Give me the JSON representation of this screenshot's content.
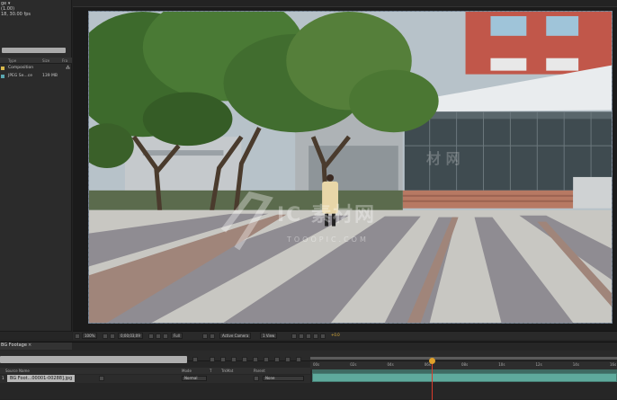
{
  "project": {
    "footage_title": "ge ▾",
    "footage_info_1": "(1.00)",
    "footage_info_2": "18, 30.00 fps",
    "columns": {
      "type": "Type",
      "size": "Size",
      "fps": "Fra"
    },
    "items": [
      {
        "type": "Composition",
        "size": "",
        "swatch": "#d8b84a",
        "icon": "composition-icon",
        "extra": "⁂"
      },
      {
        "type": "JPEG Se...ce",
        "size": "139 MB",
        "swatch": "#5aa7b0",
        "icon": "footage-icon",
        "extra": ""
      }
    ]
  },
  "viewer": {
    "watermark": "IC 素材网",
    "watermark_sub": "TOOOPIC.COM",
    "watermark_top": "材 网",
    "toolbar": {
      "zoom": "100%",
      "timecode": "0;00;03;09",
      "resolution": "Full",
      "camera": "Active Camera",
      "view": "1 View",
      "exposure": "+0.0"
    }
  },
  "timeline": {
    "tab_label": "BG Footage",
    "tab_close": "×",
    "columns": {
      "source_name": "Source Name",
      "mode": "Mode",
      "t": "T",
      "trkmat": "TrkMat",
      "parent": "Parent"
    },
    "layer": {
      "number": "1",
      "name": "BG Foot...00001-00288].jpg",
      "mode": "Normal",
      "parent": "None"
    },
    "ruler_ticks": [
      "00s",
      "02s",
      "04s",
      "06s",
      "08s",
      "10s",
      "12s",
      "14s",
      "16s"
    ],
    "playhead_fraction": 0.4
  },
  "colors": {
    "accent_layer": "#5eaa9c",
    "playhead": "#d83c2c",
    "composition_swatch": "#d8b84a",
    "footage_swatch": "#5aa7b0"
  }
}
